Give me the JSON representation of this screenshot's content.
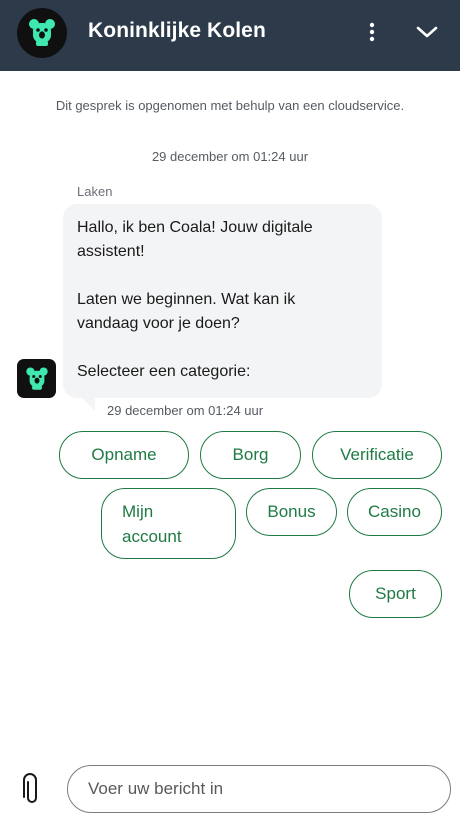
{
  "header": {
    "title": "Koninklijke Kolen",
    "logo_icon": "koala-logo-icon",
    "more_icon": "more-vertical-icon",
    "collapse_icon": "chevron-down-icon"
  },
  "notice": "Dit gesprek is opgenomen met behulp van een cloudservice.",
  "date_separator": "29 december om 01:24 uur",
  "message": {
    "sender": "Laken",
    "lines": [
      "Hallo, ik ben Coala! Jouw digitale",
      "assistent!",
      "",
      "Laten we beginnen. Wat kan ik",
      "vandaag voor je doen?",
      "",
      "Selecteer een categorie:"
    ],
    "time": "29 december om 01:24 uur"
  },
  "categories": [
    {
      "label": "Opname"
    },
    {
      "label": "Borg"
    },
    {
      "label": "Verificatie"
    },
    {
      "label": "Mijn account",
      "lines": [
        "Mijn",
        "account"
      ]
    },
    {
      "label": "Bonus"
    },
    {
      "label": "Casino"
    },
    {
      "label": "Sport"
    }
  ],
  "composer": {
    "placeholder": "Voer uw bericht in",
    "attach_icon": "paperclip-icon"
  },
  "colors": {
    "header_bg": "#2d3a4a",
    "accent_green": "#1f7a44",
    "logo_mint": "#3ee8b0",
    "bubble_bg": "#f3f4f6"
  }
}
